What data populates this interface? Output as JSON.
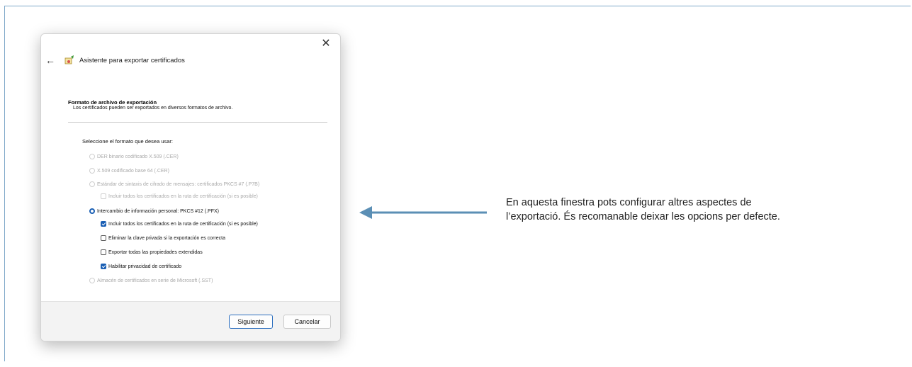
{
  "dialog": {
    "title": "Asistente para exportar certificados",
    "close_glyph": "✕",
    "back_glyph": "←",
    "icons": [
      "close-icon",
      "back-arrow-icon",
      "certificate-wizard-icon"
    ],
    "section_title": "Formato de archivo de exportación",
    "section_desc": "Los certificados pueden ser exportados en diversos formatos de archivo.",
    "prompt": "Seleccione el formato que desea usar:",
    "options": {
      "der": "DER binario codificado X.509 (.CER)",
      "base64": "X.509 codificado base 64 (.CER)",
      "pkcs7": "Estándar de sintaxis de cifrado de mensajes: certificados PKCS #7 (.P7B)",
      "pkcs7_include": "Incluir todos los certificados en la ruta de certificación (si es posible)",
      "pkcs12": "Intercambio de información personal: PKCS #12 (.PFX)",
      "pkcs12_include": "Incluir todos los certificados en la ruta de certificación (si es posible)",
      "pkcs12_delete_key": "Eliminar la clave privada si la exportación es correcta",
      "pkcs12_export_props": "Exportar todas las propiedades extendidas",
      "pkcs12_privacy": "Habilitar privacidad de certificado",
      "sst": "Almacén de certificados en serie de Microsoft (.SST)"
    },
    "selected_format": "pkcs12",
    "checked": {
      "pkcs7_include": false,
      "pkcs12_include": true,
      "pkcs12_delete_key": false,
      "pkcs12_export_props": false,
      "pkcs12_privacy": true
    },
    "next_label": "Siguiente",
    "cancel_label": "Cancelar"
  },
  "annotation": {
    "line1": "En aquesta finestra pots configurar altres aspectes de",
    "line2": "l’exportació. És recomanable deixar les opcions per defecte."
  },
  "colors": {
    "accent": "#1a5fb4",
    "arrow": "#5b8fb5",
    "frame": "#7fa8c9",
    "disabled_text": "#a9a9a9"
  }
}
